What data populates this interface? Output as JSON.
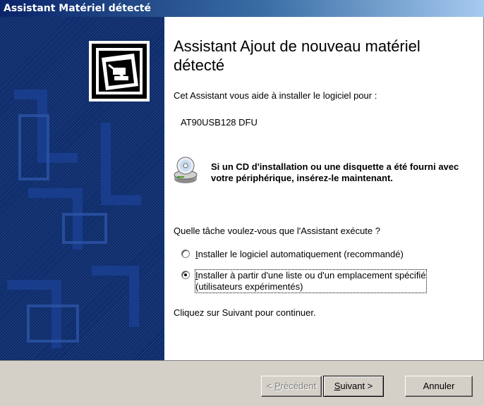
{
  "window": {
    "title": "Assistant Matériel détecté"
  },
  "header": {
    "title": "Assistant Ajout de nouveau matériel détecté"
  },
  "content": {
    "intro": "Cet Assistant vous aide à installer le logiciel pour :",
    "device_name": "AT90USB128 DFU",
    "cd_message": "Si un CD d'installation ou une disquette a été fourni avec votre périphérique, insérez-le maintenant.",
    "question": "Quelle tâche voulez-vous que l'Assistant exécute ?",
    "options": [
      {
        "label_key": "I",
        "label_rest": "nstaller le logiciel automatiquement (recommandé)",
        "selected": false
      },
      {
        "label_key": "I",
        "label_rest": "nstaller à partir d'une liste ou d'un emplacement spécifié",
        "label_line2": "(utilisateurs expérimentés)",
        "selected": true
      }
    ],
    "continue_text": "Cliquez sur Suivant pour continuer."
  },
  "buttons": {
    "back": {
      "prefix": "< ",
      "key": "P",
      "rest": "récédent",
      "enabled": false
    },
    "next": {
      "key": "S",
      "rest": "uivant >",
      "enabled": true
    },
    "cancel": {
      "label": "Annuler",
      "enabled": true
    }
  },
  "icons": {
    "hardware": "hardware-wizard-icon",
    "cd": "cd-disk-icon"
  },
  "colors": {
    "title_bar_start": "#0a246a",
    "title_bar_end": "#a6caf0",
    "left_panel": "#0b2a6b",
    "dialog_face": "#d4d0c8",
    "disabled_text": "#808080"
  }
}
